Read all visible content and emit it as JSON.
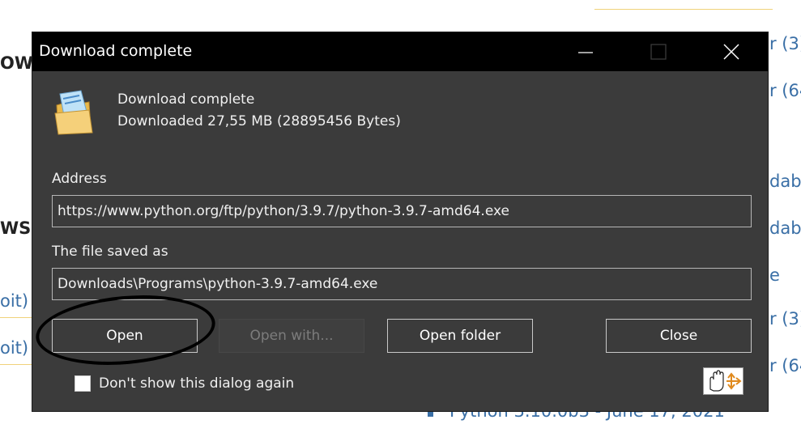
{
  "background": {
    "fragments": {
      "f1": "r (3)",
      "f2": "r (64",
      "f3": "dab",
      "f4": "dab",
      "f5": "r (3)",
      "f6": "r (64",
      "f7": "oit)",
      "f8": "oit)",
      "f9": "OW",
      "f10": "WS",
      "f11": "Python 3.10.0b3 - June 17, 2021",
      "f12": "e"
    }
  },
  "dialog": {
    "title": "Download complete",
    "window_controls": {
      "minimize": "—",
      "maximize": "☐",
      "close": "✕"
    },
    "header": {
      "status": "Download complete",
      "details": "Downloaded 27,55  MB (28895456 Bytes)",
      "icon": "open-folder-icon"
    },
    "address_label": "Address",
    "address_value": "https://www.python.org/ftp/python/3.9.7/python-3.9.7-amd64.exe",
    "saved_label": "The file saved as",
    "saved_value": "Downloads\\Programs\\python-3.9.7-amd64.exe",
    "buttons": {
      "open": "Open",
      "open_with": "Open with...",
      "open_folder": "Open folder",
      "close": "Close"
    },
    "checkbox_label": "Don't show this dialog again",
    "checkbox_checked": false,
    "corner_icon": "hand-drag-arrows-icon"
  },
  "colors": {
    "dialog_bg": "#3b3b3b",
    "titlebar_bg": "#000000",
    "annotation_ellipse": "#000000"
  }
}
